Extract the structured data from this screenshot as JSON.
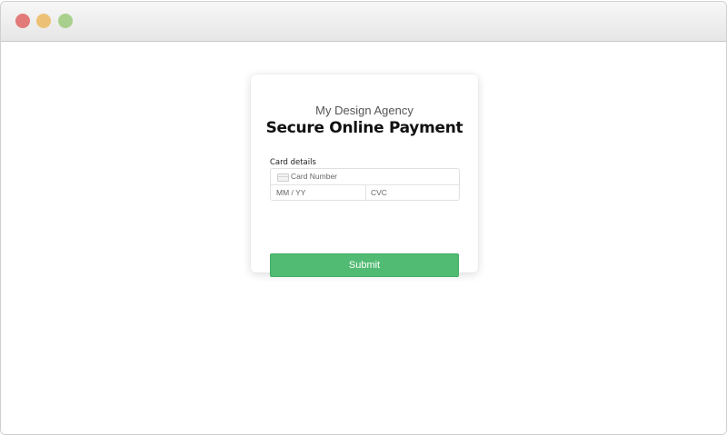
{
  "window": {
    "controls": {
      "close_color": "#e27a7a",
      "minimize_color": "#ecc175",
      "zoom_color": "#a9cf8c"
    }
  },
  "form": {
    "agency_name": "My Design Agency",
    "title": "Secure Online Payment",
    "card_details_label": "Card details",
    "card_number_placeholder": "Card Number",
    "expiry_placeholder": "MM / YY",
    "cvc_placeholder": "CVC",
    "submit_label": "Submit",
    "card_icon": "credit-card-icon"
  },
  "colors": {
    "submit_bg": "#52bb73",
    "submit_text": "#ffffff"
  }
}
